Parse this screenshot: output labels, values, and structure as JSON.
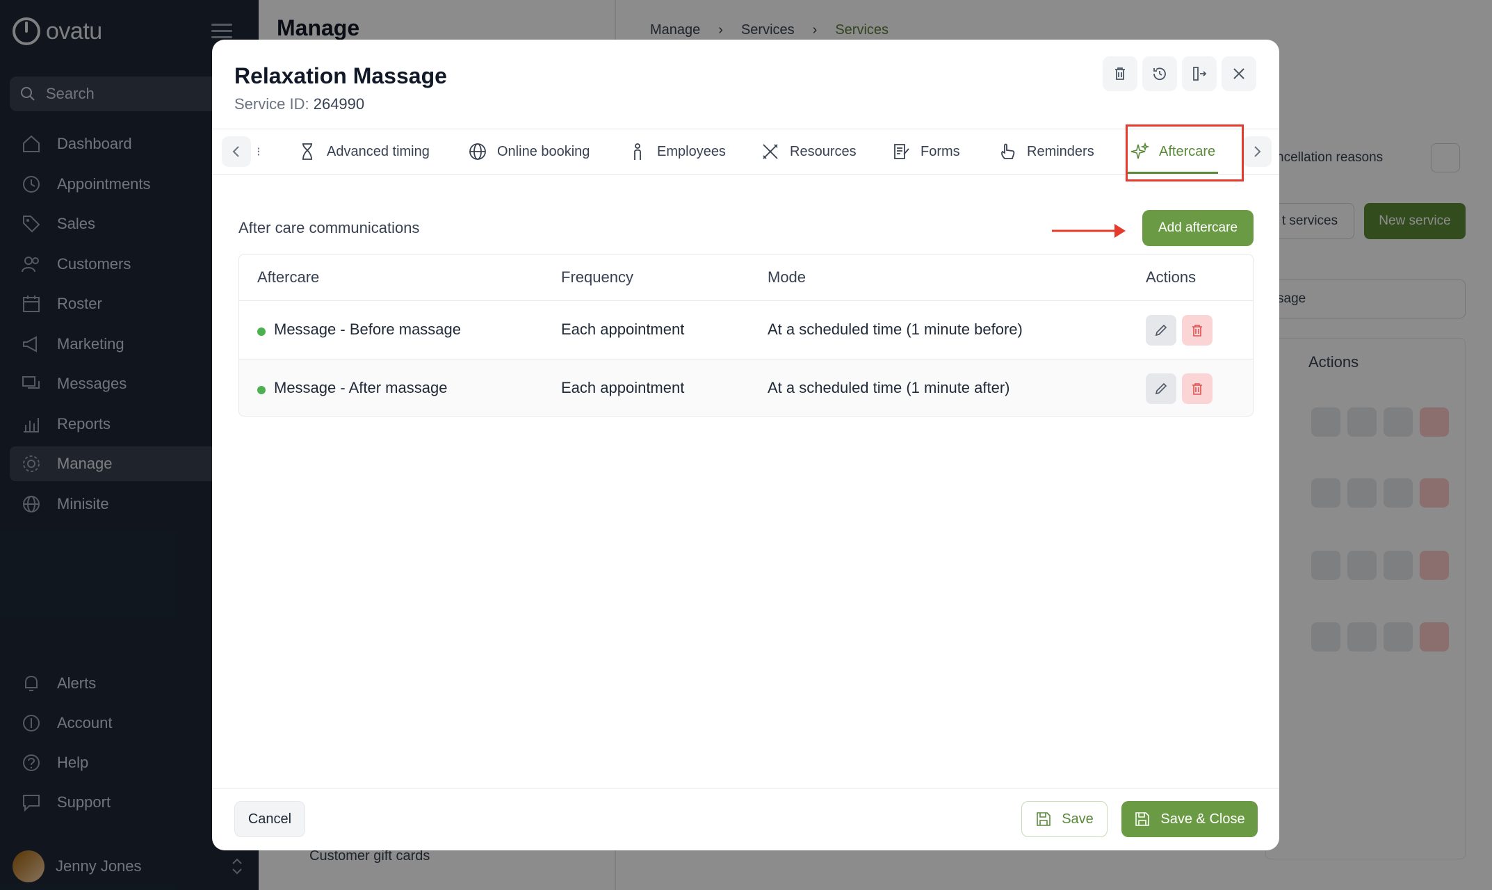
{
  "app": {
    "logo_text": "ovatu",
    "search_label": "Search",
    "nav": [
      {
        "label": "Dashboard",
        "icon": "home-icon"
      },
      {
        "label": "Appointments",
        "icon": "clock-icon"
      },
      {
        "label": "Sales",
        "icon": "tag-icon"
      },
      {
        "label": "Customers",
        "icon": "users-icon"
      },
      {
        "label": "Roster",
        "icon": "calendar-icon"
      },
      {
        "label": "Marketing",
        "icon": "megaphone-icon"
      },
      {
        "label": "Messages",
        "icon": "chat-icon"
      },
      {
        "label": "Reports",
        "icon": "chart-icon"
      },
      {
        "label": "Manage",
        "icon": "gear-icon",
        "active": true
      },
      {
        "label": "Minisite",
        "icon": "globe-icon"
      }
    ],
    "bottom_nav": [
      {
        "label": "Alerts",
        "icon": "bell-icon"
      },
      {
        "label": "Account",
        "icon": "account-icon"
      },
      {
        "label": "Help",
        "icon": "help-icon"
      },
      {
        "label": "Support",
        "icon": "support-icon"
      }
    ],
    "user_name": "Jenny Jones"
  },
  "background": {
    "page_title": "Manage",
    "breadcrumbs": [
      "Manage",
      "Services",
      "Services"
    ],
    "tab_partial": "ncellation reasons",
    "btn_partial": "t services",
    "new_service": "New service",
    "select_partial": "sage",
    "actions_header": "Actions",
    "gift_cards": "Customer gift cards"
  },
  "modal": {
    "title": "Relaxation Massage",
    "service_id_label": "Service ID:",
    "service_id": "264990",
    "tabs": [
      {
        "label": "Advanced timing",
        "icon": "hourglass-icon"
      },
      {
        "label": "Online booking",
        "icon": "globe-icon"
      },
      {
        "label": "Employees",
        "icon": "person-icon"
      },
      {
        "label": "Resources",
        "icon": "tools-icon"
      },
      {
        "label": "Forms",
        "icon": "forms-icon"
      },
      {
        "label": "Reminders",
        "icon": "hand-icon"
      },
      {
        "label": "Aftercare",
        "icon": "sparkle-icon",
        "active": true
      }
    ],
    "section_title": "After care communications",
    "add_button": "Add aftercare",
    "table": {
      "headers": [
        "Aftercare",
        "Frequency",
        "Mode",
        "Actions"
      ],
      "rows": [
        {
          "name": "Message - Before massage",
          "frequency": "Each appointment",
          "mode": "At a scheduled time (1 minute before)"
        },
        {
          "name": "Message - After massage",
          "frequency": "Each appointment",
          "mode": "At a scheduled time (1 minute after)"
        }
      ]
    },
    "footer": {
      "cancel": "Cancel",
      "save": "Save",
      "save_close": "Save & Close"
    }
  },
  "colors": {
    "sidebar_bg": "#1f2937",
    "brand_green": "#6b9a45",
    "annotation_red": "#e53b2c",
    "status_green": "#4caf50"
  }
}
